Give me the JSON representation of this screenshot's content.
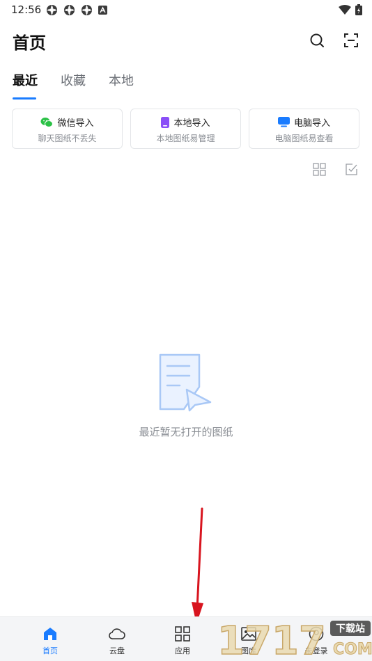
{
  "status_bar": {
    "time": "12:56"
  },
  "header": {
    "title": "首页"
  },
  "tabs": [
    {
      "label": "最近",
      "active": true
    },
    {
      "label": "收藏",
      "active": false
    },
    {
      "label": "本地",
      "active": false
    }
  ],
  "import_cards": [
    {
      "title": "微信导入",
      "subtitle": "聊天图纸不丢失",
      "icon": "wechat-icon",
      "color": "#2bc146"
    },
    {
      "title": "本地导入",
      "subtitle": "本地图纸易管理",
      "icon": "phone-icon",
      "color": "#8a4ff7"
    },
    {
      "title": "电脑导入",
      "subtitle": "电脑图纸易查看",
      "icon": "monitor-icon",
      "color": "#1a7cff"
    }
  ],
  "empty_state": {
    "message": "最近暂无打开的图纸"
  },
  "bottom_nav": [
    {
      "label": "首页",
      "icon": "home-icon",
      "active": true
    },
    {
      "label": "云盘",
      "icon": "cloud-icon",
      "active": false
    },
    {
      "label": "应用",
      "icon": "apps-grid-icon",
      "active": false
    },
    {
      "label": "图库",
      "icon": "gallery-icon",
      "active": false
    },
    {
      "label": "未登录",
      "icon": "user-icon",
      "active": false
    }
  ],
  "watermark": {
    "text": "1717",
    "tag": "下载站",
    "suffix": "COM"
  },
  "colors": {
    "accent": "#1a7cff",
    "annotation_arrow": "#d8151f"
  }
}
